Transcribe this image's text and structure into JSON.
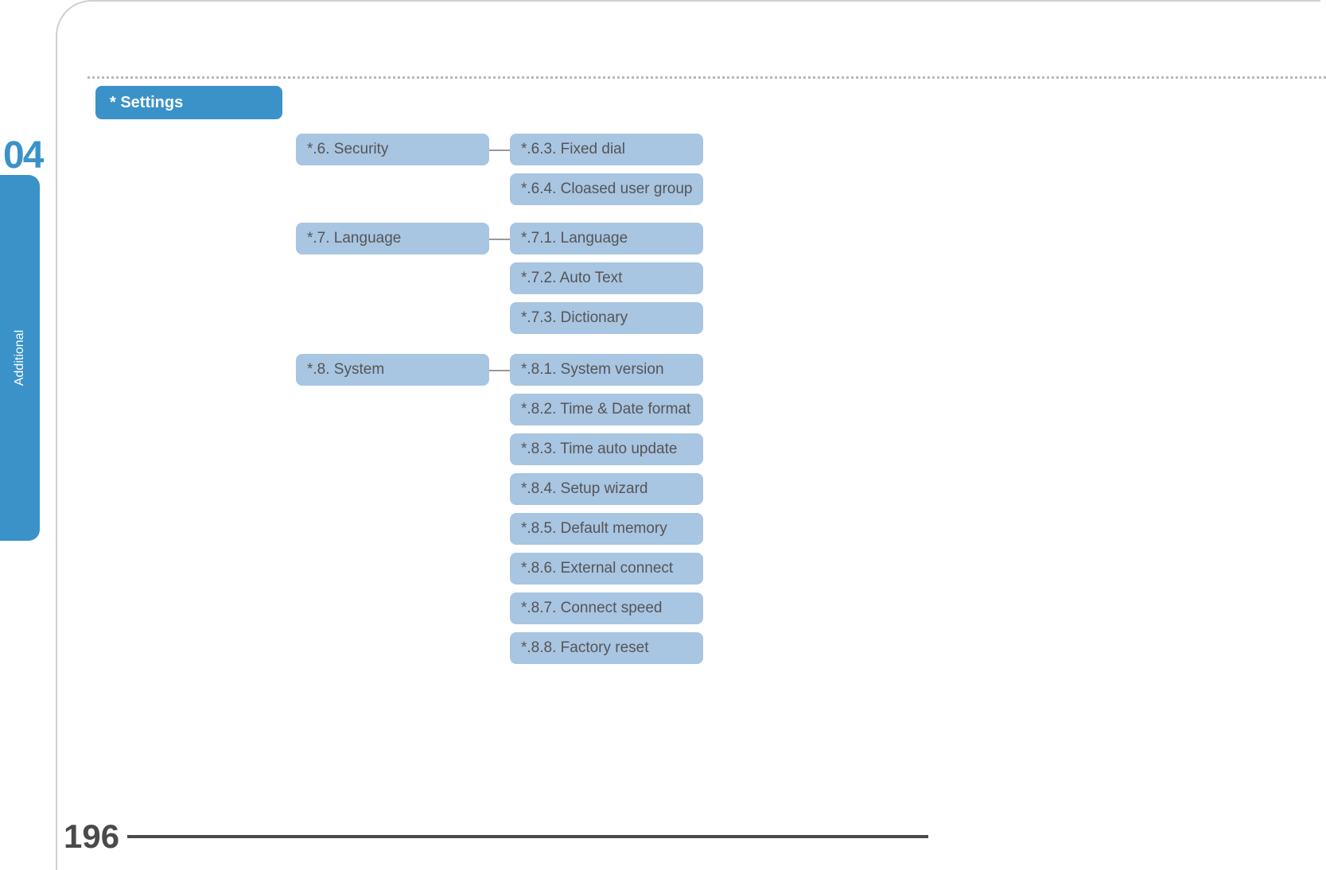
{
  "chapter_number": "04",
  "side_tab": "Additional",
  "page_number": "196",
  "header_pill": "* Settings",
  "categories": [
    {
      "label": "*.6. Security",
      "subs": [
        "*.6.3. Fixed dial",
        "*.6.4. Cloased user group"
      ]
    },
    {
      "label": "*.7. Language",
      "subs": [
        "*.7.1. Language",
        "*.7.2. Auto Text",
        "*.7.3. Dictionary"
      ]
    },
    {
      "label": "*.8.  System",
      "subs": [
        "*.8.1. System version",
        "*.8.2. Time & Date format",
        "*.8.3. Time auto update",
        "*.8.4. Setup wizard",
        "*.8.5. Default memory",
        "*.8.6. External connect",
        "*.8.7. Connect speed",
        "*.8.8. Factory reset"
      ]
    }
  ]
}
